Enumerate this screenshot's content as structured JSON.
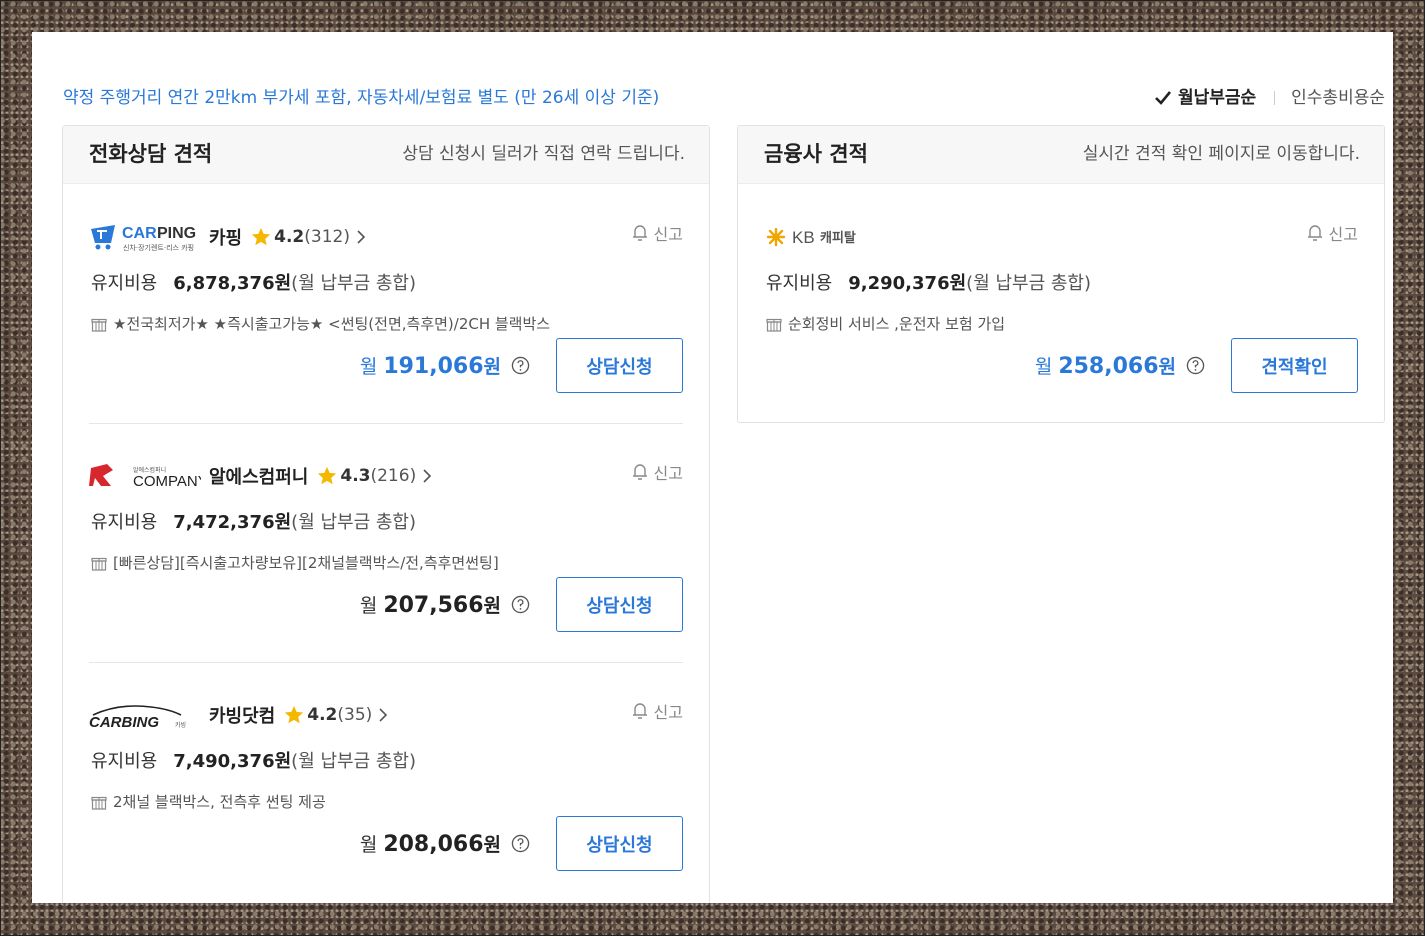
{
  "notice": "약정 주행거리 연간 2만km 부가세 포함, 자동차세/보험료 별도 (만 26세 이상 기준)",
  "sort": {
    "active": "월납부금순",
    "inactive": "인수총비용순"
  },
  "colors": {
    "accent": "#2a78d8"
  },
  "phone_section": {
    "title": "전화상담 견적",
    "subtitle": "상담 신청시 딜러가 직접 연락 드립니다.",
    "dealers": [
      {
        "logo": "CARPING",
        "logo_sub": "신차·장기렌트·리스 카핑",
        "name": "카핑",
        "rating": "4.2",
        "reviews": "(312)",
        "report": "신고",
        "cost_label": "유지비용",
        "cost": "6,878,376원",
        "cost_suffix": "(월 납부금 총합)",
        "desc": "★전국최저가★ ★즉시출고가능★ <썬팅(전면,측후면)/2CH 블랙박스",
        "per_month": "월",
        "price": "191,066",
        "won": "원",
        "button": "상담신청"
      },
      {
        "logo": "COMPANY",
        "logo_sub": "알에스컴퍼니",
        "name": "알에스컴퍼니",
        "rating": "4.3",
        "reviews": "(216)",
        "report": "신고",
        "cost_label": "유지비용",
        "cost": "7,472,376원",
        "cost_suffix": "(월 납부금 총합)",
        "desc": "[빠른상담][즉시출고차량보유][2채널블랙박스/전,측후면썬팅]",
        "per_month": "월",
        "price": "207,566",
        "won": "원",
        "button": "상담신청"
      },
      {
        "logo": "CARBING",
        "logo_sub": "카빙",
        "name": "카빙닷컴",
        "rating": "4.2",
        "reviews": "(35)",
        "report": "신고",
        "cost_label": "유지비용",
        "cost": "7,490,376원",
        "cost_suffix": "(월 납부금 총합)",
        "desc": "2채널 블랙박스, 전측후 썬팅 제공",
        "per_month": "월",
        "price": "208,066",
        "won": "원",
        "button": "상담신청"
      }
    ]
  },
  "finance_section": {
    "title": "금융사 견적",
    "subtitle": "실시간 견적 확인 페이지로 이동합니다.",
    "dealer": {
      "logo": "KB",
      "logo_sub": "캐피탈",
      "report": "신고",
      "cost_label": "유지비용",
      "cost": "9,290,376원",
      "cost_suffix": "(월 납부금 총합)",
      "desc": "순회정비 서비스 ,운전자 보험 가입",
      "per_month": "월",
      "price": "258,066",
      "won": "원",
      "button": "견적확인"
    }
  }
}
